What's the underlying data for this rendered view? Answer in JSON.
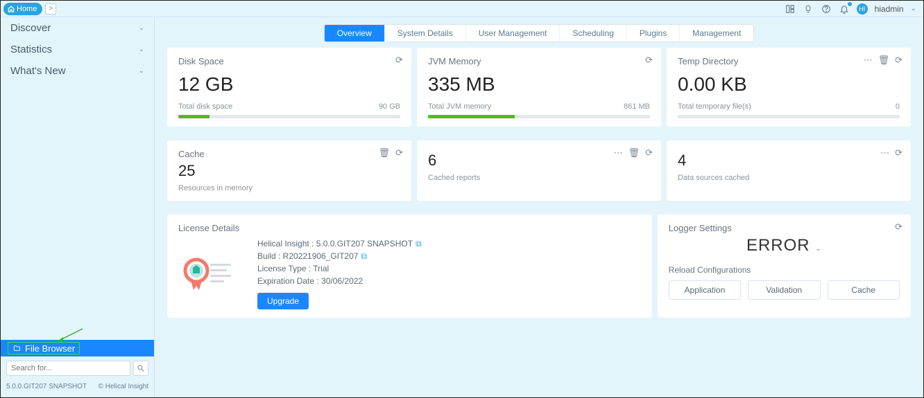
{
  "breadcrumb": {
    "home": "Home"
  },
  "top": {
    "avatar": "HI",
    "user": "hiadmin"
  },
  "sidebar": {
    "items": [
      {
        "label": "Discover"
      },
      {
        "label": "Statistics"
      },
      {
        "label": "What's New"
      }
    ],
    "file_browser": "File Browser",
    "search_placeholder": "Search for...",
    "version": "5.0.0.GIT207 SNAPSHOT",
    "product": "Helical Insight"
  },
  "tabs": [
    {
      "label": "Overview",
      "active": true
    },
    {
      "label": "System Details"
    },
    {
      "label": "User Management"
    },
    {
      "label": "Scheduling"
    },
    {
      "label": "Plugins"
    },
    {
      "label": "Management"
    }
  ],
  "cards": {
    "disk": {
      "title": "Disk Space",
      "value": "12 GB",
      "sub_left": "Total disk space",
      "sub_right": "90 GB",
      "progress_pct": 14
    },
    "jvm": {
      "title": "JVM Memory",
      "value": "335 MB",
      "sub_left": "Total JVM memory",
      "sub_right": "861 MB",
      "progress_pct": 39
    },
    "temp": {
      "title": "Temp Directory",
      "value": "0.00 KB",
      "sub_left": "Total temporary file(s)",
      "sub_right": "0",
      "progress_pct": 0
    },
    "cache": {
      "title": "Cache",
      "value": "25",
      "sub": "Resources in memory"
    },
    "reports": {
      "value": "6",
      "sub": "Cached reports"
    },
    "datasources": {
      "value": "4",
      "sub": "Data sources cached"
    },
    "license": {
      "title": "License Details",
      "line1": "Helical Insight : 5.0.0.GIT207 SNAPSHOT",
      "line2": "Build : R20221906_GIT207",
      "line3": "License Type : Trial",
      "line4": "Expiration Date : 30/06/2022",
      "upgrade": "Upgrade"
    },
    "logger": {
      "title": "Logger Settings",
      "level": "ERROR",
      "reload": "Reload Configurations",
      "btns": [
        "Application",
        "Validation",
        "Cache"
      ]
    }
  }
}
